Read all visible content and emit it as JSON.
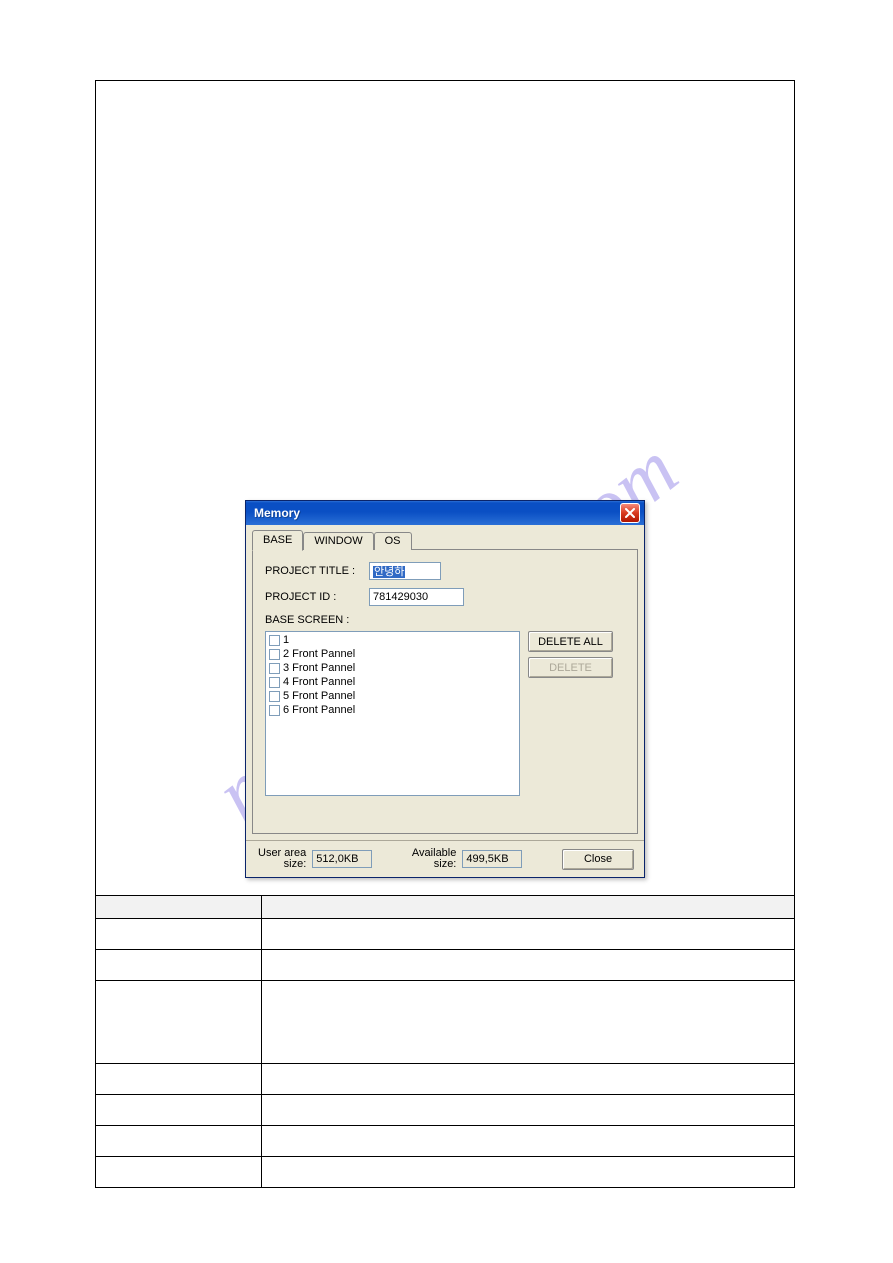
{
  "watermark": "manualshive.com",
  "dialog": {
    "title": "Memory",
    "tabs": [
      "BASE",
      "WINDOW",
      "OS"
    ],
    "active_tab": 0,
    "project_title_label": "PROJECT TITLE :",
    "project_title_value": "안녕하",
    "project_id_label": "PROJECT ID :",
    "project_id_value": "781429030",
    "base_screen_label": "BASE SCREEN :",
    "items": [
      "1",
      "2 Front Pannel",
      "3 Front Pannel",
      "4 Front Pannel",
      "5 Front Pannel",
      "6 Front Pannel"
    ],
    "delete_all_label": "DELETE ALL",
    "delete_label": "DELETE",
    "user_area_label": "User area\nsize:",
    "user_area_value": "512,0KB",
    "available_label": "Available\nsize:",
    "available_value": "499,5KB",
    "close_label": "Close"
  }
}
